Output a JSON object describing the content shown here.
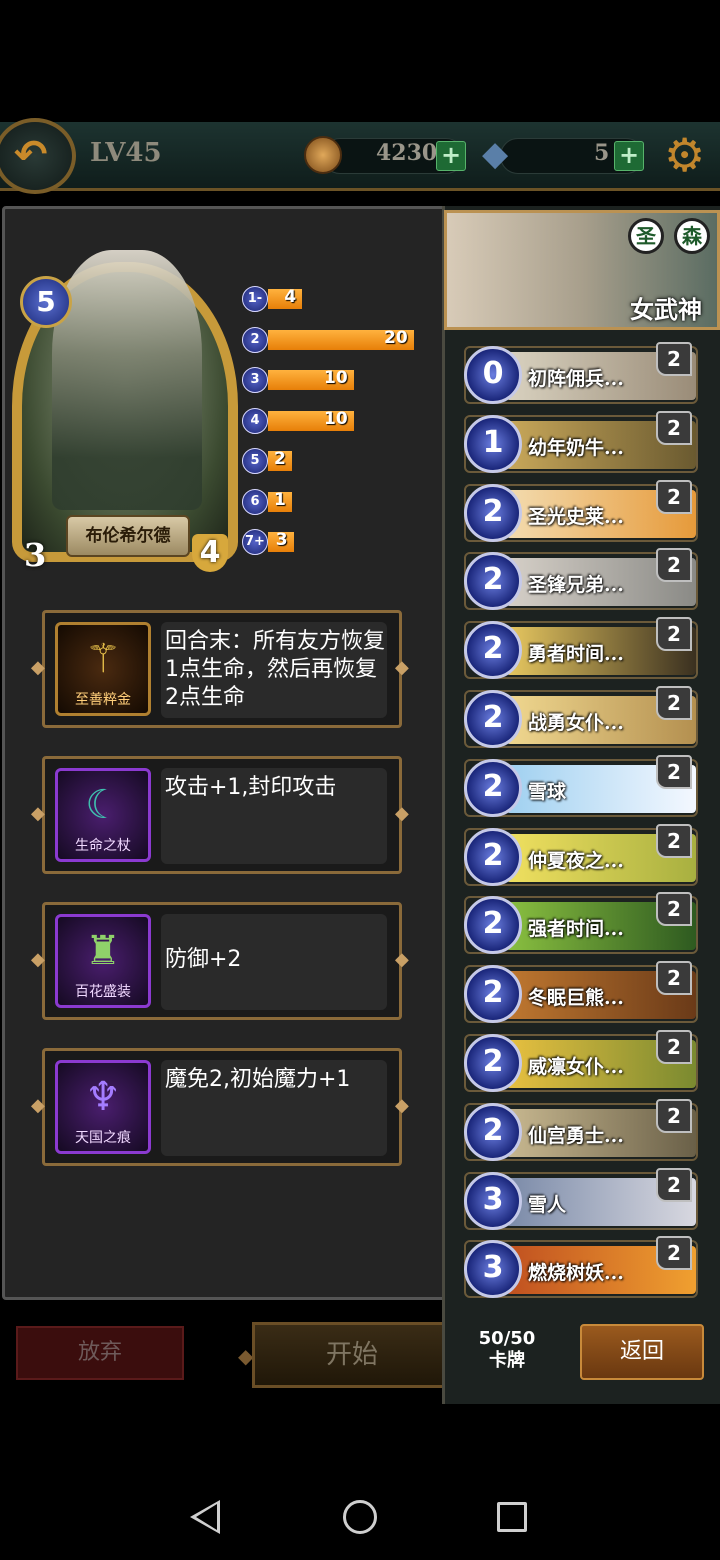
{
  "top_bar": {
    "level": "LV45",
    "gold": "4230",
    "gems": "5",
    "icons": [
      "back-arrow-icon",
      "coin-icon",
      "gem-icon",
      "plus-icon",
      "gear-icon"
    ]
  },
  "hero": {
    "name": "布伦希尔德",
    "cost": "5",
    "attack": "3",
    "health": "4",
    "banner_title": "女武神",
    "factions": [
      "圣",
      "森"
    ]
  },
  "mana_curve": [
    {
      "cost": "1-",
      "count": "4",
      "value": 4
    },
    {
      "cost": "2",
      "count": "20",
      "value": 20
    },
    {
      "cost": "3",
      "count": "10",
      "value": 10
    },
    {
      "cost": "4",
      "count": "10",
      "value": 10
    },
    {
      "cost": "5",
      "count": "2",
      "value": 2
    },
    {
      "cost": "6",
      "count": "1",
      "value": 1
    },
    {
      "cost": "7+",
      "count": "3",
      "value": 3
    }
  ],
  "abilities": [
    {
      "icon_label": "至善粹金",
      "text": "回合末：所有友方恢复1点生命，然后再恢复2点生命"
    },
    {
      "icon_label": "生命之杖",
      "text": "攻击+1,封印攻击"
    },
    {
      "icon_label": "百花盛装",
      "text": "防御+2"
    },
    {
      "icon_label": "天国之痕",
      "text": "魔免2,初始魔力+1"
    }
  ],
  "buttons": {
    "abandon": "放弃",
    "start": "开始",
    "return": "返回"
  },
  "deck": {
    "count": "50/50",
    "count_label": "卡牌",
    "cards": [
      {
        "cost": "0",
        "name": "初阵佣兵...",
        "count": "2"
      },
      {
        "cost": "1",
        "name": "幼年奶牛...",
        "count": "2"
      },
      {
        "cost": "2",
        "name": "圣光史莱...",
        "count": "2"
      },
      {
        "cost": "2",
        "name": "圣锋兄弟...",
        "count": "2"
      },
      {
        "cost": "2",
        "name": "勇者时间...",
        "count": "2"
      },
      {
        "cost": "2",
        "name": "战勇女仆...",
        "count": "2"
      },
      {
        "cost": "2",
        "name": "雪球",
        "count": "2"
      },
      {
        "cost": "2",
        "name": "仲夏夜之...",
        "count": "2"
      },
      {
        "cost": "2",
        "name": "强者时间...",
        "count": "2"
      },
      {
        "cost": "2",
        "name": "冬眠巨熊...",
        "count": "2"
      },
      {
        "cost": "2",
        "name": "威凛女仆...",
        "count": "2"
      },
      {
        "cost": "2",
        "name": "仙宫勇士...",
        "count": "2"
      },
      {
        "cost": "3",
        "name": "雪人",
        "count": "2"
      },
      {
        "cost": "3",
        "name": "燃烧树妖...",
        "count": "2"
      }
    ]
  }
}
